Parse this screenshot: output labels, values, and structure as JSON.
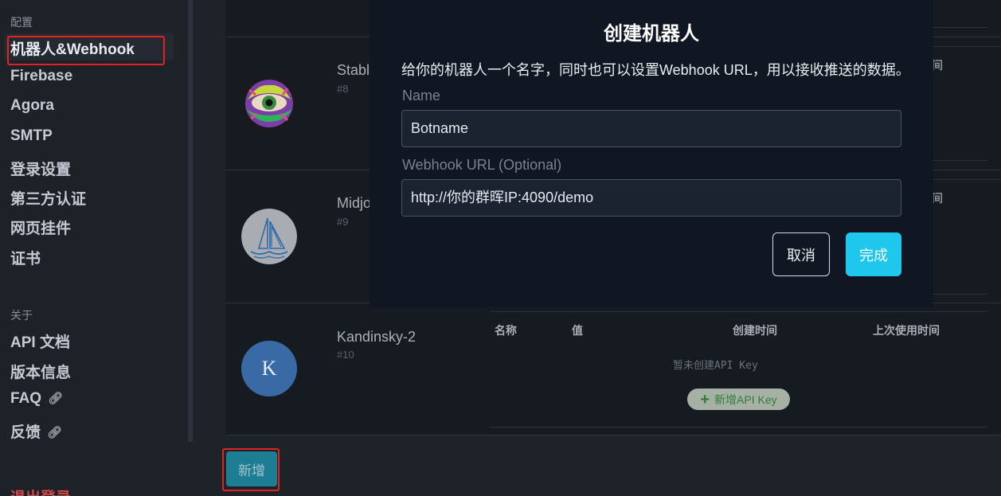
{
  "sidebar": {
    "section_config": "配置",
    "items": [
      {
        "label": "机器人&Webhook"
      },
      {
        "label": "Firebase"
      },
      {
        "label": "Agora"
      },
      {
        "label": "SMTP"
      },
      {
        "label": "登录设置"
      },
      {
        "label": "第三方认证"
      },
      {
        "label": "网页挂件"
      },
      {
        "label": "证书"
      }
    ],
    "section_about": "关于",
    "about_items": [
      {
        "label": "API 文档"
      },
      {
        "label": "版本信息"
      },
      {
        "label": "FAQ"
      },
      {
        "label": "反馈"
      }
    ],
    "logout": "退出登录"
  },
  "bots": [
    {
      "name": "Stabl",
      "id": "#8"
    },
    {
      "name": "Midjo",
      "id": "#9"
    },
    {
      "name": "Kandinsky-2",
      "id": "#10",
      "avatar_letter": "K"
    }
  ],
  "api_table": {
    "headers": [
      "名称",
      "值",
      "创建时间",
      "上次使用时间"
    ],
    "side_header_partial": "间",
    "empty_text": "暂未创建API Key",
    "add_button": "新增API Key"
  },
  "new_button": "新增",
  "modal": {
    "title": "创建机器人",
    "description": "给你的机器人一个名字，同时也可以设置Webhook URL，用以接收推送的数据。",
    "name_label": "Name",
    "name_value": "Botname",
    "webhook_label": "Webhook URL (Optional)",
    "webhook_value": "http://你的群晖IP:4090/demo",
    "cancel_label": "取消",
    "done_label": "完成"
  },
  "colors": {
    "accent": "#1fc7ec",
    "highlight_box": "#e12323",
    "logout": "#d04848"
  }
}
